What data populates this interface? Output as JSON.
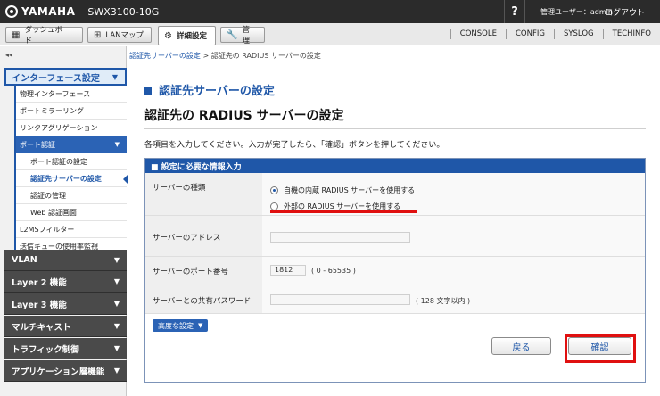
{
  "header": {
    "brand": "YAMAHA",
    "model": "SWX3100-10G",
    "help": "?",
    "user": "管理ユーザー：admin",
    "logout": "ログアウト"
  },
  "nav": {
    "tabs": [
      {
        "label": "ダッシュボード",
        "icon": "dashboard-icon"
      },
      {
        "label": "LANマップ",
        "icon": "lan-map-icon"
      },
      {
        "label": "詳細設定",
        "icon": "gear-icon"
      },
      {
        "label": "管　理",
        "icon": "wrench-icon"
      }
    ],
    "tools": [
      "CONSOLE",
      "CONFIG",
      "SYSLOG",
      "TECHINFO"
    ]
  },
  "sidebar": {
    "collapse": "◂◂",
    "section_active": "インターフェース設定",
    "items": [
      {
        "label": "物理インターフェース"
      },
      {
        "label": "ポートミラーリング"
      },
      {
        "label": "リンクアグリゲーション"
      },
      {
        "label": "ポート認証"
      },
      {
        "label": "ポート認証の設定"
      },
      {
        "label": "認証先サーバーの設定"
      },
      {
        "label": "認証の管理"
      },
      {
        "label": "Web 認証画面"
      },
      {
        "label": "L2MSフィルター"
      },
      {
        "label": "送信キューの使用率監視"
      }
    ],
    "sections": [
      "VLAN",
      "Layer 2 機能",
      "Layer 3 機能",
      "マルチキャスト",
      "トラフィック制御",
      "アプリケーション層機能"
    ]
  },
  "breadcrumb": {
    "link": "認証先サーバーの設定",
    "sep": " > ",
    "current": "認証先の RADIUS サーバーの設定"
  },
  "page": {
    "section_title": "認証先サーバーの設定",
    "title": "認証先の RADIUS サーバーの設定",
    "description": "各項目を入力してください。入力が完了したら、「確認」ボタンを押してください。"
  },
  "form": {
    "panel_title": "■ 設定に必要な情報入力",
    "server_type_label": "サーバーの種類",
    "option_internal": "自機の内蔵 RADIUS サーバーを使用する",
    "option_external": "外部の RADIUS サーバーを使用する",
    "address_label": "サーバーのアドレス",
    "address_value": "",
    "port_label": "サーバーのポート番号",
    "port_value": "1812",
    "port_range": "( 0 - 65535 )",
    "password_label": "サーバーとの共有パスワード",
    "password_value": "",
    "password_hint": "( 128 文字以内 )",
    "advanced": "高度な設定",
    "back": "戻る",
    "confirm": "確認"
  }
}
